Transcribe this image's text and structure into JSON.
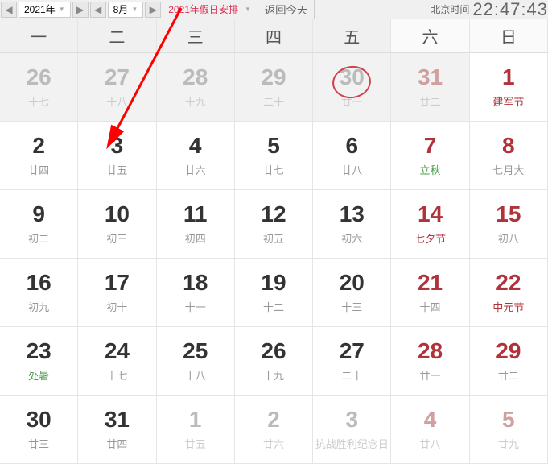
{
  "header": {
    "year": "2021年",
    "month": "8月",
    "holiday_link": "2021年假日安排",
    "today_btn": "返回今天",
    "tz_label": "北京时间",
    "clock": "22:47:43"
  },
  "dow": [
    "一",
    "二",
    "三",
    "四",
    "五",
    "六",
    "日"
  ],
  "weeks": [
    [
      {
        "d": "26",
        "l": "十七",
        "cls": "prev first-row"
      },
      {
        "d": "27",
        "l": "十八",
        "cls": "prev first-row"
      },
      {
        "d": "28",
        "l": "十九",
        "cls": "prev first-row"
      },
      {
        "d": "29",
        "l": "二十",
        "cls": "prev first-row"
      },
      {
        "d": "30",
        "l": "廿一",
        "cls": "prev first-row circled"
      },
      {
        "d": "31",
        "l": "廿二",
        "cls": "prev first-row weekend"
      },
      {
        "d": "1",
        "l": "建军节",
        "cls": "weekend festival"
      }
    ],
    [
      {
        "d": "2",
        "l": "廿四",
        "cls": ""
      },
      {
        "d": "3",
        "l": "廿五",
        "cls": ""
      },
      {
        "d": "4",
        "l": "廿六",
        "cls": ""
      },
      {
        "d": "5",
        "l": "廿七",
        "cls": ""
      },
      {
        "d": "6",
        "l": "廿八",
        "cls": ""
      },
      {
        "d": "7",
        "l": "立秋",
        "cls": "weekend solar-term"
      },
      {
        "d": "8",
        "l": "七月大",
        "cls": "weekend"
      }
    ],
    [
      {
        "d": "9",
        "l": "初二",
        "cls": ""
      },
      {
        "d": "10",
        "l": "初三",
        "cls": ""
      },
      {
        "d": "11",
        "l": "初四",
        "cls": ""
      },
      {
        "d": "12",
        "l": "初五",
        "cls": ""
      },
      {
        "d": "13",
        "l": "初六",
        "cls": ""
      },
      {
        "d": "14",
        "l": "七夕节",
        "cls": "weekend festival"
      },
      {
        "d": "15",
        "l": "初八",
        "cls": "weekend"
      }
    ],
    [
      {
        "d": "16",
        "l": "初九",
        "cls": ""
      },
      {
        "d": "17",
        "l": "初十",
        "cls": ""
      },
      {
        "d": "18",
        "l": "十一",
        "cls": ""
      },
      {
        "d": "19",
        "l": "十二",
        "cls": ""
      },
      {
        "d": "20",
        "l": "十三",
        "cls": ""
      },
      {
        "d": "21",
        "l": "十四",
        "cls": "weekend"
      },
      {
        "d": "22",
        "l": "中元节",
        "cls": "weekend festival"
      }
    ],
    [
      {
        "d": "23",
        "l": "处暑",
        "cls": "solar-term"
      },
      {
        "d": "24",
        "l": "十七",
        "cls": ""
      },
      {
        "d": "25",
        "l": "十八",
        "cls": ""
      },
      {
        "d": "26",
        "l": "十九",
        "cls": ""
      },
      {
        "d": "27",
        "l": "二十",
        "cls": ""
      },
      {
        "d": "28",
        "l": "廿一",
        "cls": "weekend"
      },
      {
        "d": "29",
        "l": "廿二",
        "cls": "weekend"
      }
    ],
    [
      {
        "d": "30",
        "l": "廿三",
        "cls": ""
      },
      {
        "d": "31",
        "l": "廿四",
        "cls": ""
      },
      {
        "d": "1",
        "l": "廿五",
        "cls": "next"
      },
      {
        "d": "2",
        "l": "廿六",
        "cls": "next"
      },
      {
        "d": "3",
        "l": "抗战胜利纪念日",
        "cls": "next festival"
      },
      {
        "d": "4",
        "l": "廿八",
        "cls": "next weekend"
      },
      {
        "d": "5",
        "l": "廿九",
        "cls": "next weekend"
      }
    ]
  ]
}
